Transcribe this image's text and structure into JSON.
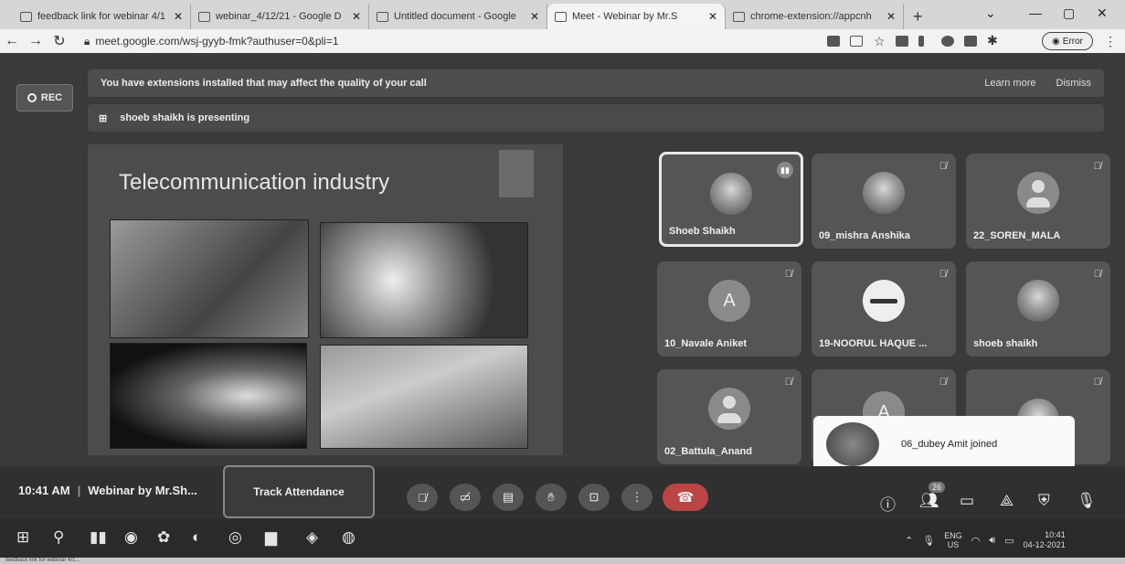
{
  "browser": {
    "tabs": [
      {
        "label": "feedback link for webinar 4/1",
        "active": false
      },
      {
        "label": "webinar_4/12/21 - Google D",
        "active": false
      },
      {
        "label": "Untitled document - Google",
        "active": false
      },
      {
        "label": "Meet - Webinar by Mr.S",
        "active": true
      },
      {
        "label": "chrome-extension://appcnh",
        "active": false
      }
    ],
    "new_tab": "+",
    "url": "meet.google.com/wsj-gyyb-fmk?authuser=0&pli=1",
    "error_label": "Error"
  },
  "meet": {
    "warning_text": "You have extensions installed that may affect the quality of your call",
    "learn_more": "Learn more",
    "dismiss": "Dismiss",
    "rec_label": "REC",
    "presenting_text": "shoeb shaikh is presenting",
    "slide_title": "Telecommunication industry",
    "participants": [
      {
        "name": "Shoeb Shaikh",
        "avatar": "photo",
        "speaking": true
      },
      {
        "name": "09_mishra Anshika",
        "avatar": "photo",
        "muted": true
      },
      {
        "name": "22_SOREN_MALA",
        "avatar": "person",
        "muted": true
      },
      {
        "name": "10_Navale Aniket",
        "avatar": "letter",
        "letter": "A",
        "muted": true
      },
      {
        "name": "19-NOORUL HAQUE ...",
        "avatar": "logo",
        "muted": true
      },
      {
        "name": "shoeb shaikh",
        "avatar": "photo",
        "muted": true
      },
      {
        "name": "02_Battula_Anand",
        "avatar": "person",
        "muted": true
      },
      {
        "name": "",
        "avatar": "letter",
        "letter": "A",
        "muted": true
      },
      {
        "name": "",
        "avatar": "photo",
        "muted": true
      }
    ],
    "toast_text": "06_dubey Amit joined",
    "time": "10:41 AM",
    "meeting_name": "Webinar by Mr.Sh...",
    "track_attendance": "Track Attendance",
    "participant_count": "26"
  },
  "taskbar": {
    "lang_top": "ENG",
    "lang_bottom": "US",
    "clock_time": "10:41",
    "clock_date": "04-12-2021"
  },
  "status_bar": "feedback link for webinar 4/1..."
}
